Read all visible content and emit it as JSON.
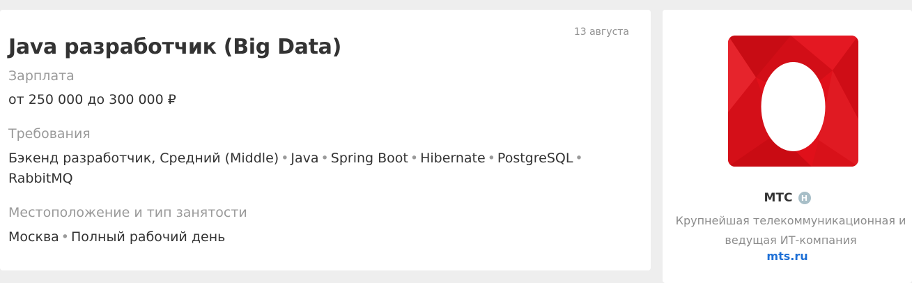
{
  "vacancy": {
    "title": "Java разработчик (Big Data)",
    "date": "13 августа",
    "salary_label": "Зарплата",
    "salary_value": "от 250 000 до 300 000 ₽",
    "requirements_label": "Требования",
    "requirements": [
      "Бэкенд разработчик, Средний (Middle)",
      "Java",
      "Spring Boot",
      "Hibernate",
      "PostgreSQL",
      "RabbitMQ"
    ],
    "location_label": "Местоположение и тип занятости",
    "location": [
      "Москва",
      "Полный рабочий день"
    ]
  },
  "company": {
    "name": "МТС",
    "badge": "H",
    "description": "Крупнейшая телекоммуникационная и ведущая ИТ-компания",
    "link": "mts.ru",
    "logo_icon": "mts-egg-logo-icon",
    "logo_color": "#e0101a"
  },
  "colors": {
    "background": "#eeeeee",
    "card": "#ffffff",
    "text": "#333333",
    "muted": "#9a9a9a",
    "link": "#1d6fd6"
  }
}
